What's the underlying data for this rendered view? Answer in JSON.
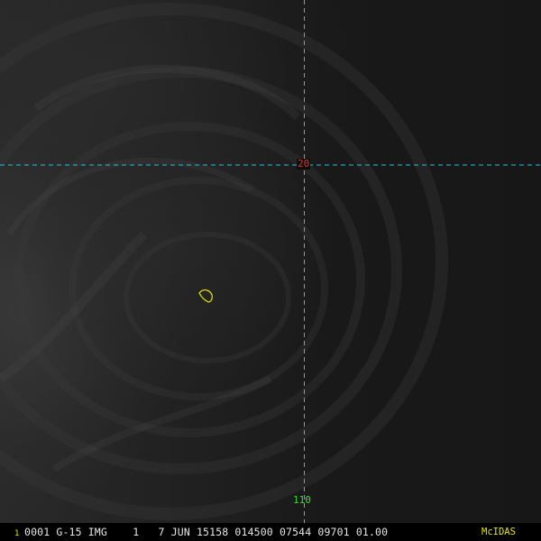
{
  "image": {
    "description_colors": {
      "background": "#1c1c1c",
      "grid_line": "#1fc8d8",
      "latitude_label": "#e03030",
      "longitude_label": "#30e030",
      "contour": "#e8e800",
      "status_text": "#e6e6e6",
      "status_accent": "#e8e800"
    }
  },
  "grid": {
    "latitude_label": "20",
    "longitude_label": "110"
  },
  "status_bar": {
    "frame_number": "1",
    "image_info": "0001 G-15 IMG    1   7 JUN 15158 014500 07544 09701 01.00",
    "software": "McIDAS"
  }
}
